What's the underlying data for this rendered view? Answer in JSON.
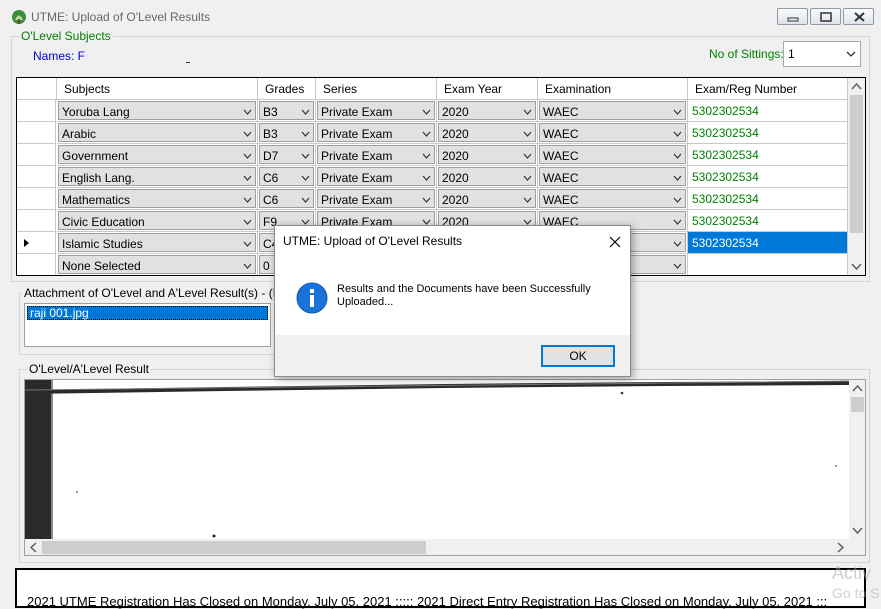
{
  "window": {
    "title": "UTME: Upload of O'Level Results",
    "icon": "app-leaf-icon"
  },
  "subjects_group": {
    "legend": "O'Level Subjects",
    "names_label": "Names: F",
    "sittings_label": "No of Sittings:",
    "sittings_value": "1"
  },
  "grid": {
    "columns": [
      "Subjects",
      "Grades",
      "Series",
      "Exam Year",
      "Examination",
      "Exam/Reg Number"
    ],
    "rows": [
      {
        "subject": "Yoruba Lang",
        "grade": "B3",
        "series": "Private Exam",
        "year": "2020",
        "exam": "WAEC",
        "reg": "5302302534"
      },
      {
        "subject": "Arabic",
        "grade": "B3",
        "series": "Private Exam",
        "year": "2020",
        "exam": "WAEC",
        "reg": "5302302534"
      },
      {
        "subject": "Government",
        "grade": "D7",
        "series": "Private Exam",
        "year": "2020",
        "exam": "WAEC",
        "reg": "5302302534"
      },
      {
        "subject": "English Lang.",
        "grade": "C6",
        "series": "Private Exam",
        "year": "2020",
        "exam": "WAEC",
        "reg": "5302302534"
      },
      {
        "subject": "Mathematics",
        "grade": "C6",
        "series": "Private Exam",
        "year": "2020",
        "exam": "WAEC",
        "reg": "5302302534"
      },
      {
        "subject": "Civic Education",
        "grade": "F9",
        "series": "Private Exam",
        "year": "2020",
        "exam": "WAEC",
        "reg": "5302302534"
      },
      {
        "subject": "Islamic Studies",
        "grade": "C4",
        "series": "",
        "year": "",
        "exam": "",
        "reg": "5302302534"
      },
      {
        "subject": "None Selected",
        "grade": "0",
        "series": "",
        "year": "",
        "exam": "",
        "reg": ""
      }
    ]
  },
  "attachment": {
    "legend": "Attachment of O'Level and A'Level Result(s) - (File Siz",
    "files": [
      "raji 001.jpg"
    ]
  },
  "result_panel": {
    "legend": "O'Level/A'Level Result"
  },
  "dialog": {
    "title": "UTME: Upload of O'Level Results",
    "message_line1": "Results and the Documents have been Successfully",
    "message_line2": "Uploaded...",
    "ok_label": "OK",
    "icon": "info-icon"
  },
  "ticker": "2021 UTME Registration Has Closed on Monday, July 05, 2021 ::::: 2021 Direct Entry Registration Has Closed on Monday, July 05, 2021 :::",
  "watermark": {
    "line1": "Activ",
    "line2": "Go to S"
  },
  "colors": {
    "accent": "#0078d7",
    "legend_green": "#008000",
    "names_blue": "#0000d0"
  }
}
